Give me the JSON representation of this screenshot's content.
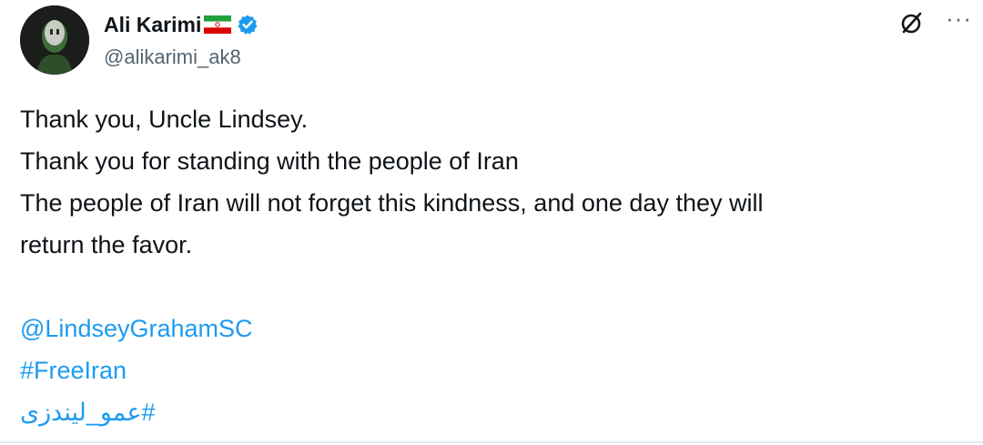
{
  "author": {
    "display_name": "Ali Karimi",
    "handle": "@alikarimi_ak8",
    "flag_icon": "iran-flag-icon",
    "verified_icon": "verified-badge-icon"
  },
  "actions": {
    "grok_icon": "grok-icon",
    "more_label": "···"
  },
  "tweet": {
    "lines": [
      "Thank you, Uncle Lindsey.",
      "Thank you for standing with the people of Iran",
      "The people of Iran will not forget this kindness, and one day they will",
      "return the favor."
    ],
    "mention": "@LindseyGrahamSC",
    "hashtag_1": "#FreeIran",
    "hashtag_2": "#عمو_لیندزی"
  },
  "colors": {
    "link": "#1d9bf0",
    "verified": "#1d9bf0",
    "secondary_text": "#536471"
  }
}
